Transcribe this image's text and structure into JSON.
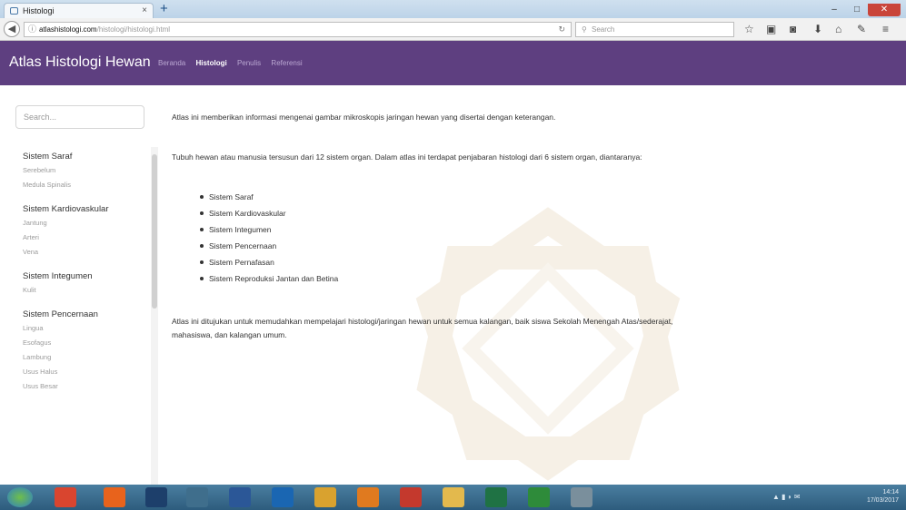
{
  "browser": {
    "tab_title": "Histologi",
    "tab_close": "×",
    "new_tab": "+",
    "url_host": "atlashistologi.com",
    "url_path": "/histologi/histologi.html",
    "search_placeholder": "Search",
    "toolbar_icons": [
      "star-icon",
      "clipboard-icon",
      "pocket-icon",
      "download-icon",
      "home-icon",
      "extension-icon",
      "menu-icon"
    ],
    "window_controls": {
      "minimize": "–",
      "maximize": "□",
      "close": "✕"
    }
  },
  "site": {
    "brand": "Atlas Histologi Hewan",
    "nav": [
      {
        "label": "Beranda",
        "active": false
      },
      {
        "label": "Histologi",
        "active": true
      },
      {
        "label": "Penulis",
        "active": false
      },
      {
        "label": "Referensi",
        "active": false
      }
    ],
    "header_color": "#5e3f80"
  },
  "sidebar": {
    "search_placeholder": "Search...",
    "categories": [
      {
        "label": "Sistem Saraf",
        "items": [
          "Serebelum",
          "Medula Spinalis"
        ]
      },
      {
        "label": "Sistem Kardiovaskular",
        "items": [
          "Jantung",
          "Arteri",
          "Vena"
        ]
      },
      {
        "label": "Sistem Integumen",
        "items": [
          "Kulit"
        ]
      },
      {
        "label": "Sistem Pencernaan",
        "items": [
          "Lingua",
          "Esofagus",
          "Lambung",
          "Usus Halus",
          "Usus Besar"
        ]
      }
    ]
  },
  "main": {
    "paragraph1": "Atlas ini memberikan informasi mengenai gambar mikroskopis jaringan hewan yang disertai dengan keterangan.",
    "paragraph2": "Tubuh hewan atau manusia tersusun dari 12 sistem organ. Dalam atlas ini terdapat penjabaran histologi dari 6 sistem organ, diantaranya:",
    "systems": [
      "Sistem Saraf",
      "Sistem Kardiovaskular",
      "Sistem Integumen",
      "Sistem Pencernaan",
      "Sistem Pernafasan",
      "Sistem Reproduksi Jantan dan Betina"
    ],
    "paragraph3": "Atlas ini ditujukan untuk memudahkan mempelajari histologi/jaringan hewan untuk semua kalangan, baik siswa Sekolah Menengah Atas/sederajat, mahasiswa, dan kalangan umum."
  },
  "taskbar": {
    "apps": [
      {
        "name": "chrome",
        "color": "#d9452f"
      },
      {
        "name": "app-orange",
        "color": "#e8631c"
      },
      {
        "name": "photoshop",
        "color": "#1d3f6b"
      },
      {
        "name": "wifi-tool",
        "color": "#3f6e8c"
      },
      {
        "name": "word",
        "color": "#2b5797"
      },
      {
        "name": "bluetooth",
        "color": "#1a66b2"
      },
      {
        "name": "chrome-browser",
        "color": "#d9a22f"
      },
      {
        "name": "firefox",
        "color": "#e07a1f"
      },
      {
        "name": "media",
        "color": "#c4392d"
      },
      {
        "name": "folder",
        "color": "#e3b94d"
      },
      {
        "name": "excel",
        "color": "#1f7244"
      },
      {
        "name": "app-green",
        "color": "#2e8b3a"
      },
      {
        "name": "paint",
        "color": "#7a8f9c"
      }
    ],
    "time": "14:14",
    "date": "17/03/2017"
  }
}
